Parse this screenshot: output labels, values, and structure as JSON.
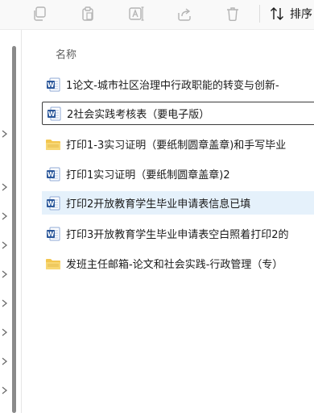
{
  "toolbar": {
    "sort_label": "排序",
    "actions": [
      "copy-icon",
      "paste-icon",
      "rename-icon",
      "share-icon",
      "delete-icon",
      "sort-icon"
    ]
  },
  "listing": {
    "column_name": "名称",
    "items": [
      {
        "name": "1论文-城市社区治理中行政职能的转变与创新-",
        "type": "word-document-icon",
        "state": "normal"
      },
      {
        "name": "2社会实践考核表（要电子版）",
        "type": "word-document-icon",
        "state": "focused"
      },
      {
        "name": "打印1-3实习证明（要纸制圆章盖章)和手写毕业",
        "type": "folder-icon",
        "state": "normal"
      },
      {
        "name": "打印1实习证明（要纸制圆章盖章)2",
        "type": "word-document-icon",
        "state": "normal"
      },
      {
        "name": "打印2开放教育学生毕业申请表信息已填",
        "type": "word-document-icon",
        "state": "selected"
      },
      {
        "name": "打印3开放教育学生毕业申请表空白照着打印2的",
        "type": "word-document-icon",
        "state": "normal"
      },
      {
        "name": "发班主任邮箱-论文和社会实践-行政管理（专）",
        "type": "folder-icon",
        "state": "normal"
      }
    ]
  },
  "colors": {
    "selected_row": "#e5f1fb",
    "word_blue": "#2b579a",
    "folder_yellow": "#f3c64f"
  }
}
